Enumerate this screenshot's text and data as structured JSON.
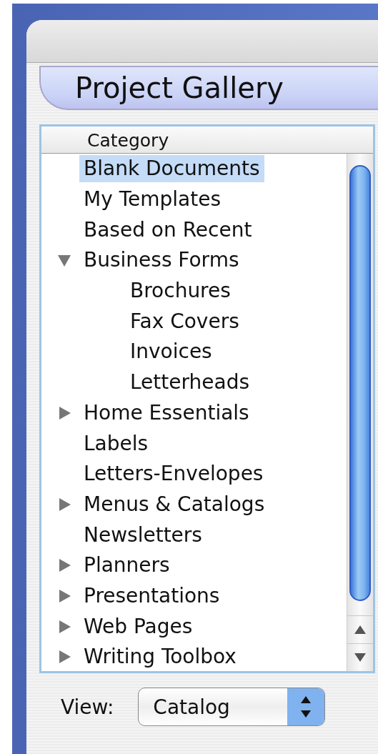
{
  "panel": {
    "title": "Project Gallery"
  },
  "list": {
    "column": "Category",
    "items": [
      {
        "label": "Blank Documents",
        "selected": true
      },
      {
        "label": "My Templates",
        "selected": false
      },
      {
        "label": "Based on Recent",
        "selected": false
      },
      {
        "label": "Business Forms",
        "selected": false,
        "expanded": true,
        "children": [
          {
            "label": "Brochures",
            "selected": false
          },
          {
            "label": "Fax Covers",
            "selected": false
          },
          {
            "label": "Invoices",
            "selected": false
          },
          {
            "label": "Letterheads",
            "selected": false
          }
        ]
      },
      {
        "label": "Home Essentials",
        "selected": false,
        "expanded": false
      },
      {
        "label": "Labels",
        "selected": false
      },
      {
        "label": "Letters-Envelopes",
        "selected": false
      },
      {
        "label": "Menus & Catalogs",
        "selected": false,
        "expanded": false
      },
      {
        "label": "Newsletters",
        "selected": false
      },
      {
        "label": "Planners",
        "selected": false,
        "expanded": false
      },
      {
        "label": "Presentations",
        "selected": false,
        "expanded": false
      },
      {
        "label": "Web Pages",
        "selected": false,
        "expanded": false
      },
      {
        "label": "Writing Toolbox",
        "selected": false,
        "expanded": false
      }
    ]
  },
  "view": {
    "label": "View:",
    "value": "Catalog"
  }
}
